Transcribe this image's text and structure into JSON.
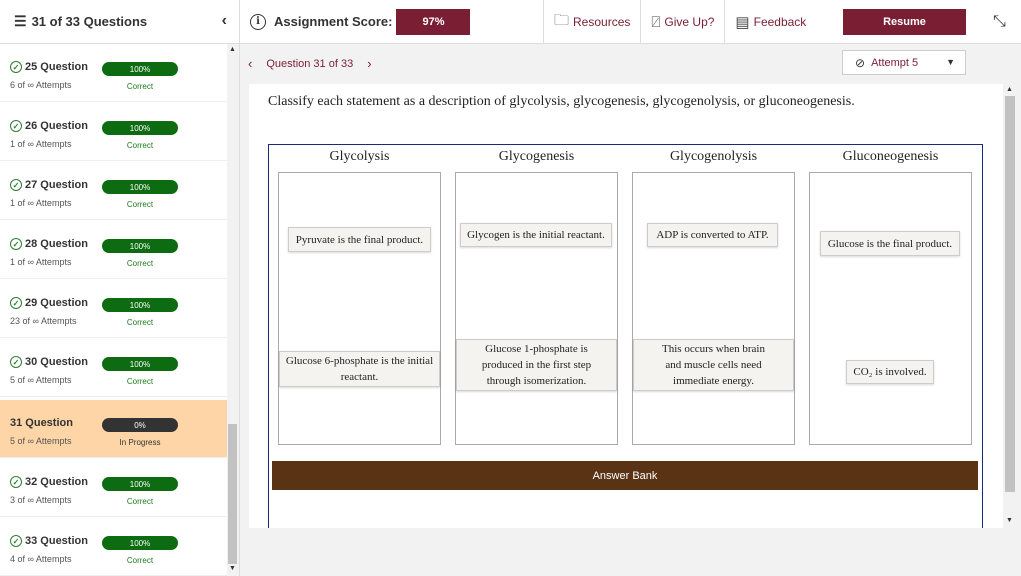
{
  "header": {
    "question_count": "31 of 33 Questions",
    "score_label": "Assignment Score:",
    "score_value": "97%",
    "tools": [
      {
        "label": "Resources",
        "icon": "folder-icon"
      },
      {
        "label": "Give Up?",
        "icon": "give-up-icon"
      },
      {
        "label": "Feedback",
        "icon": "feedback-icon"
      }
    ],
    "resume_label": "Resume"
  },
  "sidebar": {
    "items": [
      {
        "name": "25 Question",
        "attempts": "6 of ∞ Attempts",
        "percent": "100%",
        "status": "Correct"
      },
      {
        "name": "26 Question",
        "attempts": "1 of ∞ Attempts",
        "percent": "100%",
        "status": "Correct"
      },
      {
        "name": "27 Question",
        "attempts": "1 of ∞ Attempts",
        "percent": "100%",
        "status": "Correct"
      },
      {
        "name": "28 Question",
        "attempts": "1 of ∞ Attempts",
        "percent": "100%",
        "status": "Correct"
      },
      {
        "name": "29 Question",
        "attempts": "23 of ∞ Attempts",
        "percent": "100%",
        "status": "Correct"
      },
      {
        "name": "30 Question",
        "attempts": "5 of ∞ Attempts",
        "percent": "100%",
        "status": "Correct"
      },
      {
        "name": "31 Question",
        "attempts": "5 of ∞ Attempts",
        "percent": "0%",
        "status": "In Progress"
      },
      {
        "name": "32 Question",
        "attempts": "3 of ∞ Attempts",
        "percent": "100%",
        "status": "Correct"
      },
      {
        "name": "33 Question",
        "attempts": "4 of ∞ Attempts",
        "percent": "100%",
        "status": "Correct"
      }
    ]
  },
  "nav": {
    "question_label": "Question 31 of 33",
    "attempt_label": "Attempt 5"
  },
  "question": {
    "prompt": "Classify each statement as a description of glycolysis, glycogenesis, glycogenolysis, or gluconeogenesis.",
    "columns": [
      {
        "heading": "Glycolysis",
        "cards": [
          "Pyruvate is the final product.",
          "Glucose 6-phosphate is the initial reactant."
        ]
      },
      {
        "heading": "Glycogenesis",
        "cards": [
          "Glycogen is the initial reactant.",
          "Glucose 1-phosphate is produced in the first step through isomerization."
        ]
      },
      {
        "heading": "Glycogenolysis",
        "cards": [
          "ADP is converted to ATP.",
          "This occurs when brain and muscle cells need immediate energy."
        ]
      },
      {
        "heading": "Gluconeogenesis",
        "cards": [
          "Glucose is the final product.",
          "CO₂ is involved."
        ]
      }
    ],
    "answer_bank_label": "Answer Bank"
  }
}
